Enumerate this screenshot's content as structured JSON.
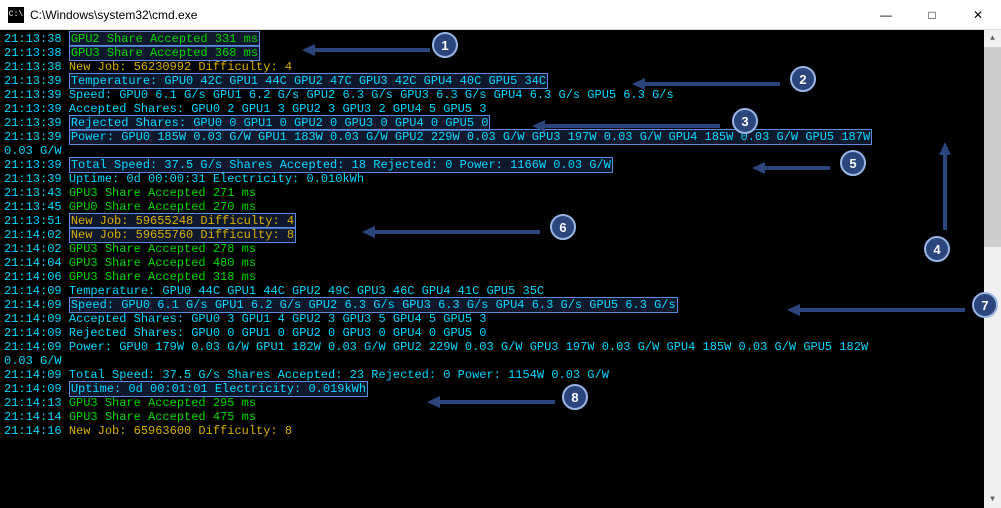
{
  "window": {
    "title": "C:\\Windows\\system32\\cmd.exe",
    "icon_label": "C:\\"
  },
  "colors": {
    "timestamp": "#00d7ff",
    "accepted": "#00d700",
    "newjob": "#d7af00",
    "info": "#00d7ff",
    "badge_bg": "#2a467d",
    "badge_border": "#9ab6e6"
  },
  "annotations": [
    {
      "num": "1"
    },
    {
      "num": "2"
    },
    {
      "num": "3"
    },
    {
      "num": "4"
    },
    {
      "num": "5"
    },
    {
      "num": "6"
    },
    {
      "num": "7"
    },
    {
      "num": "8"
    }
  ],
  "lines": [
    {
      "ts": "21:13:38",
      "cls": "green",
      "hl": true,
      "text": "GPU2 Share Accepted 331 ms"
    },
    {
      "ts": "21:13:38",
      "cls": "green",
      "hl": true,
      "text": "GPU3 Share Accepted 368 ms"
    },
    {
      "ts": "21:13:38",
      "cls": "yellow",
      "hl": false,
      "text": "New Job: 56230992 Difficulty: 4"
    },
    {
      "ts": "21:13:39",
      "cls": "cyan",
      "hl": true,
      "text": "Temperature: GPU0 42C GPU1 44C GPU2 47C GPU3 42C GPU4 40C GPU5 34C"
    },
    {
      "ts": "21:13:39",
      "cls": "cyan",
      "hl": false,
      "text": "Speed: GPU0 6.1 G/s GPU1 6.2 G/s GPU2 6.3 G/s GPU3 6.3 G/s GPU4 6.3 G/s GPU5 6.3 G/s"
    },
    {
      "ts": "21:13:39",
      "cls": "cyan",
      "hl": false,
      "text": "Accepted Shares: GPU0 2 GPU1 3 GPU2 3 GPU3 2 GPU4 5 GPU5 3"
    },
    {
      "ts": "21:13:39",
      "cls": "cyan",
      "hl": true,
      "text": "Rejected Shares: GPU0 0 GPU1 0 GPU2 0 GPU3 0 GPU4 0 GPU5 0"
    },
    {
      "ts": "21:13:39",
      "cls": "cyan",
      "hl": true,
      "text": "Power: GPU0 185W 0.03 G/W GPU1 183W 0.03 G/W GPU2 229W 0.03 G/W GPU3 197W 0.03 G/W GPU4 185W 0.03 G/W GPU5 187W"
    },
    {
      "ts": "",
      "cls": "cyan",
      "hl": false,
      "text": "0.03 G/W"
    },
    {
      "ts": "21:13:39",
      "cls": "cyan",
      "hl": true,
      "text": "Total Speed: 37.5 G/s Shares Accepted: 18 Rejected: 0 Power: 1166W 0.03 G/W"
    },
    {
      "ts": "21:13:39",
      "cls": "cyan",
      "hl": false,
      "text": "Uptime: 0d 00:00:31 Electricity: 0.010kWh"
    },
    {
      "ts": "21:13:43",
      "cls": "green",
      "hl": false,
      "text": "GPU3 Share Accepted 271 ms"
    },
    {
      "ts": "21:13:45",
      "cls": "green",
      "hl": false,
      "text": "GPU0 Share Accepted 270 ms"
    },
    {
      "ts": "21:13:51",
      "cls": "yellow",
      "hl": true,
      "text": "New Job: 59655248 Difficulty: 4"
    },
    {
      "ts": "21:14:02",
      "cls": "yellow",
      "hl": true,
      "text": "New Job: 59655760 Difficulty: 8"
    },
    {
      "ts": "21:14:02",
      "cls": "green",
      "hl": false,
      "text": "GPU3 Share Accepted 278 ms"
    },
    {
      "ts": "21:14:04",
      "cls": "green",
      "hl": false,
      "text": "GPU3 Share Accepted 480 ms"
    },
    {
      "ts": "21:14:06",
      "cls": "green",
      "hl": false,
      "text": "GPU3 Share Accepted 318 ms"
    },
    {
      "ts": "21:14:09",
      "cls": "cyan",
      "hl": false,
      "text": "Temperature: GPU0 44C GPU1 44C GPU2 49C GPU3 46C GPU4 41C GPU5 35C"
    },
    {
      "ts": "21:14:09",
      "cls": "cyan",
      "hl": true,
      "text": "Speed: GPU0 6.1 G/s GPU1 6.2 G/s GPU2 6.3 G/s GPU3 6.3 G/s GPU4 6.3 G/s GPU5 6.3 G/s"
    },
    {
      "ts": "21:14:09",
      "cls": "cyan",
      "hl": false,
      "text": "Accepted Shares: GPU0 3 GPU1 4 GPU2 3 GPU3 5 GPU4 5 GPU5 3"
    },
    {
      "ts": "21:14:09",
      "cls": "cyan",
      "hl": false,
      "text": "Rejected Shares: GPU0 0 GPU1 0 GPU2 0 GPU3 0 GPU4 0 GPU5 0"
    },
    {
      "ts": "21:14:09",
      "cls": "cyan",
      "hl": false,
      "text": "Power: GPU0 179W 0.03 G/W GPU1 182W 0.03 G/W GPU2 229W 0.03 G/W GPU3 197W 0.03 G/W GPU4 185W 0.03 G/W GPU5 182W"
    },
    {
      "ts": "",
      "cls": "cyan",
      "hl": false,
      "text": "0.03 G/W"
    },
    {
      "ts": "21:14:09",
      "cls": "cyan",
      "hl": false,
      "text": "Total Speed: 37.5 G/s Shares Accepted: 23 Rejected: 0 Power: 1154W 0.03 G/W"
    },
    {
      "ts": "21:14:09",
      "cls": "cyan",
      "hl": true,
      "text": "Uptime: 0d 00:01:01 Electricity: 0.019kWh"
    },
    {
      "ts": "21:14:13",
      "cls": "green",
      "hl": false,
      "text": "GPU3 Share Accepted 295 ms"
    },
    {
      "ts": "21:14:14",
      "cls": "green",
      "hl": false,
      "text": "GPU3 Share Accepted 475 ms"
    },
    {
      "ts": "21:14:16",
      "cls": "yellow",
      "hl": false,
      "text": "New Job: 65963600 Difficulty: 8"
    }
  ]
}
